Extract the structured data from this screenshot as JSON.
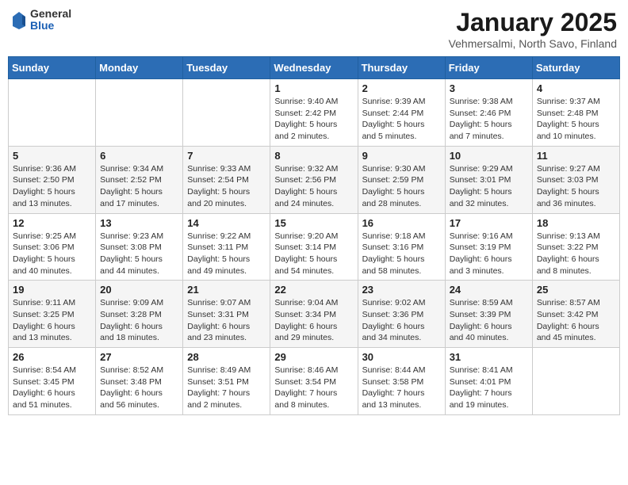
{
  "header": {
    "logo_general": "General",
    "logo_blue": "Blue",
    "title": "January 2025",
    "location": "Vehmersalmi, North Savo, Finland"
  },
  "weekdays": [
    "Sunday",
    "Monday",
    "Tuesday",
    "Wednesday",
    "Thursday",
    "Friday",
    "Saturday"
  ],
  "weeks": [
    [
      {
        "day": "",
        "info": ""
      },
      {
        "day": "",
        "info": ""
      },
      {
        "day": "",
        "info": ""
      },
      {
        "day": "1",
        "info": "Sunrise: 9:40 AM\nSunset: 2:42 PM\nDaylight: 5 hours\nand 2 minutes."
      },
      {
        "day": "2",
        "info": "Sunrise: 9:39 AM\nSunset: 2:44 PM\nDaylight: 5 hours\nand 5 minutes."
      },
      {
        "day": "3",
        "info": "Sunrise: 9:38 AM\nSunset: 2:46 PM\nDaylight: 5 hours\nand 7 minutes."
      },
      {
        "day": "4",
        "info": "Sunrise: 9:37 AM\nSunset: 2:48 PM\nDaylight: 5 hours\nand 10 minutes."
      }
    ],
    [
      {
        "day": "5",
        "info": "Sunrise: 9:36 AM\nSunset: 2:50 PM\nDaylight: 5 hours\nand 13 minutes."
      },
      {
        "day": "6",
        "info": "Sunrise: 9:34 AM\nSunset: 2:52 PM\nDaylight: 5 hours\nand 17 minutes."
      },
      {
        "day": "7",
        "info": "Sunrise: 9:33 AM\nSunset: 2:54 PM\nDaylight: 5 hours\nand 20 minutes."
      },
      {
        "day": "8",
        "info": "Sunrise: 9:32 AM\nSunset: 2:56 PM\nDaylight: 5 hours\nand 24 minutes."
      },
      {
        "day": "9",
        "info": "Sunrise: 9:30 AM\nSunset: 2:59 PM\nDaylight: 5 hours\nand 28 minutes."
      },
      {
        "day": "10",
        "info": "Sunrise: 9:29 AM\nSunset: 3:01 PM\nDaylight: 5 hours\nand 32 minutes."
      },
      {
        "day": "11",
        "info": "Sunrise: 9:27 AM\nSunset: 3:03 PM\nDaylight: 5 hours\nand 36 minutes."
      }
    ],
    [
      {
        "day": "12",
        "info": "Sunrise: 9:25 AM\nSunset: 3:06 PM\nDaylight: 5 hours\nand 40 minutes."
      },
      {
        "day": "13",
        "info": "Sunrise: 9:23 AM\nSunset: 3:08 PM\nDaylight: 5 hours\nand 44 minutes."
      },
      {
        "day": "14",
        "info": "Sunrise: 9:22 AM\nSunset: 3:11 PM\nDaylight: 5 hours\nand 49 minutes."
      },
      {
        "day": "15",
        "info": "Sunrise: 9:20 AM\nSunset: 3:14 PM\nDaylight: 5 hours\nand 54 minutes."
      },
      {
        "day": "16",
        "info": "Sunrise: 9:18 AM\nSunset: 3:16 PM\nDaylight: 5 hours\nand 58 minutes."
      },
      {
        "day": "17",
        "info": "Sunrise: 9:16 AM\nSunset: 3:19 PM\nDaylight: 6 hours\nand 3 minutes."
      },
      {
        "day": "18",
        "info": "Sunrise: 9:13 AM\nSunset: 3:22 PM\nDaylight: 6 hours\nand 8 minutes."
      }
    ],
    [
      {
        "day": "19",
        "info": "Sunrise: 9:11 AM\nSunset: 3:25 PM\nDaylight: 6 hours\nand 13 minutes."
      },
      {
        "day": "20",
        "info": "Sunrise: 9:09 AM\nSunset: 3:28 PM\nDaylight: 6 hours\nand 18 minutes."
      },
      {
        "day": "21",
        "info": "Sunrise: 9:07 AM\nSunset: 3:31 PM\nDaylight: 6 hours\nand 23 minutes."
      },
      {
        "day": "22",
        "info": "Sunrise: 9:04 AM\nSunset: 3:34 PM\nDaylight: 6 hours\nand 29 minutes."
      },
      {
        "day": "23",
        "info": "Sunrise: 9:02 AM\nSunset: 3:36 PM\nDaylight: 6 hours\nand 34 minutes."
      },
      {
        "day": "24",
        "info": "Sunrise: 8:59 AM\nSunset: 3:39 PM\nDaylight: 6 hours\nand 40 minutes."
      },
      {
        "day": "25",
        "info": "Sunrise: 8:57 AM\nSunset: 3:42 PM\nDaylight: 6 hours\nand 45 minutes."
      }
    ],
    [
      {
        "day": "26",
        "info": "Sunrise: 8:54 AM\nSunset: 3:45 PM\nDaylight: 6 hours\nand 51 minutes."
      },
      {
        "day": "27",
        "info": "Sunrise: 8:52 AM\nSunset: 3:48 PM\nDaylight: 6 hours\nand 56 minutes."
      },
      {
        "day": "28",
        "info": "Sunrise: 8:49 AM\nSunset: 3:51 PM\nDaylight: 7 hours\nand 2 minutes."
      },
      {
        "day": "29",
        "info": "Sunrise: 8:46 AM\nSunset: 3:54 PM\nDaylight: 7 hours\nand 8 minutes."
      },
      {
        "day": "30",
        "info": "Sunrise: 8:44 AM\nSunset: 3:58 PM\nDaylight: 7 hours\nand 13 minutes."
      },
      {
        "day": "31",
        "info": "Sunrise: 8:41 AM\nSunset: 4:01 PM\nDaylight: 7 hours\nand 19 minutes."
      },
      {
        "day": "",
        "info": ""
      }
    ]
  ]
}
